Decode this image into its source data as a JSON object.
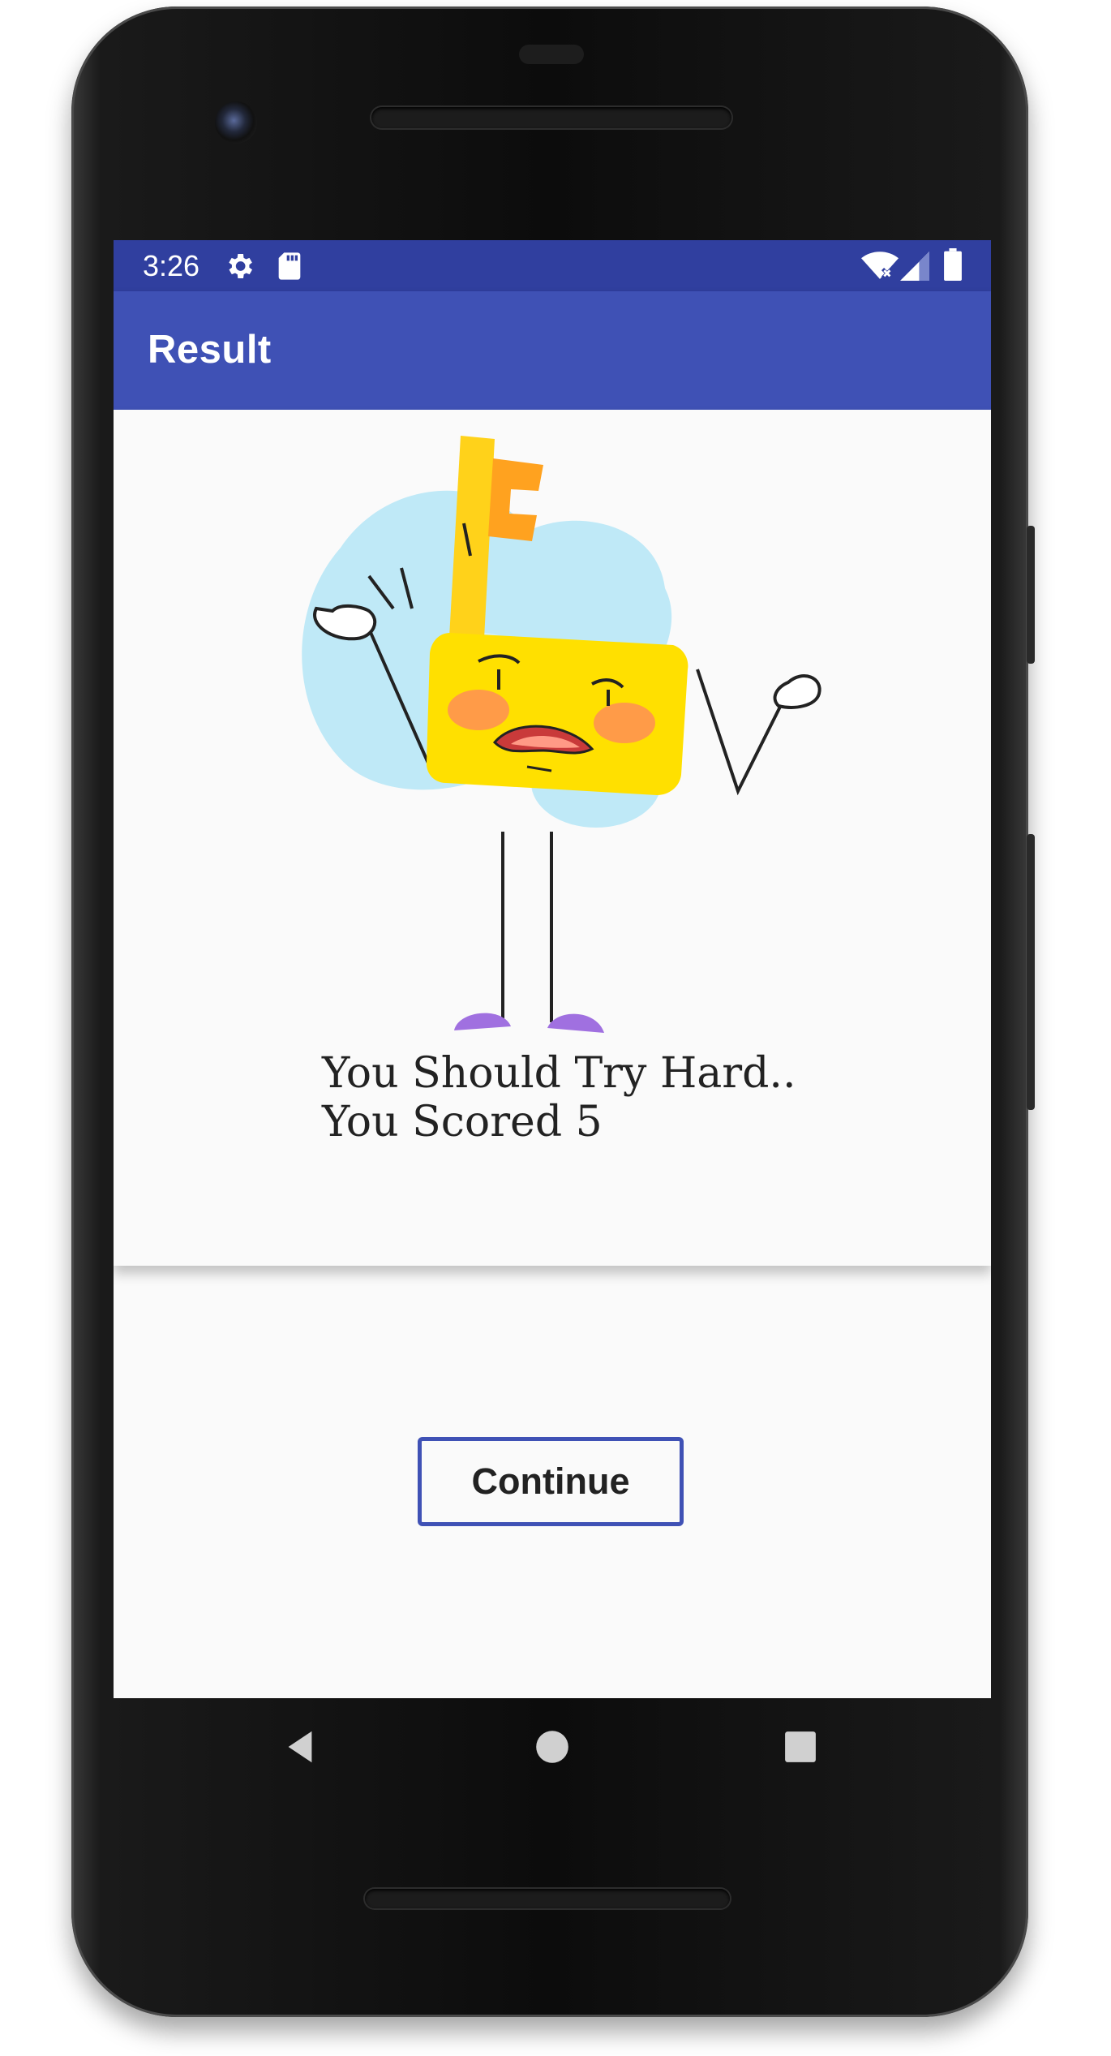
{
  "status_bar": {
    "time": "3:26",
    "icons": [
      "gear-icon",
      "sd-card-icon",
      "wifi-icon",
      "signal-icon",
      "battery-icon"
    ]
  },
  "app_bar": {
    "title": "Result"
  },
  "result": {
    "message": "You Should Try Hard..",
    "score_text": "You Scored 5"
  },
  "actions": {
    "continue_label": "Continue"
  },
  "navigation": {
    "buttons": [
      "back-icon",
      "home-icon",
      "recents-icon"
    ]
  },
  "colors": {
    "primary": "#3f51b5",
    "primary_dark": "#303f9f",
    "background": "#fafafa",
    "illustration_yellow": "#ffde00",
    "illustration_blue": "#bfe9f7",
    "illustration_purple": "#a070e0"
  }
}
